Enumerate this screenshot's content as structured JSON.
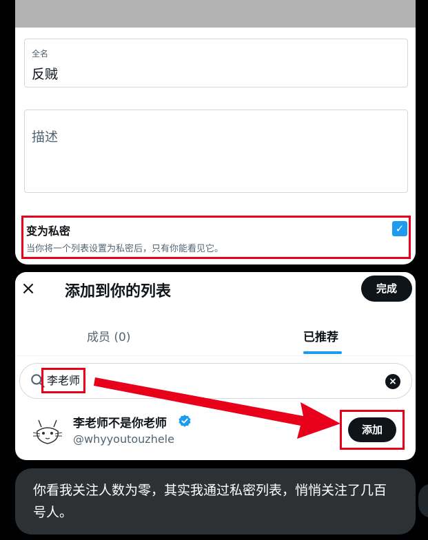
{
  "list_editor": {
    "name_label": "全名",
    "name_value": "反贼",
    "description_placeholder": "描述",
    "private_title": "变为私密",
    "private_description": "当你将一个列表设置为私密后，只有你能看见它。",
    "private_checked": true
  },
  "add_dialog": {
    "title": "添加到你的列表",
    "done_label": "完成",
    "tabs": [
      {
        "label": "成员 (0)",
        "active": false
      },
      {
        "label": "已推荐",
        "active": true
      }
    ],
    "search_value": "李老师",
    "user": {
      "name": "李老师不是你老师",
      "handle": "@whyyoutouzhele",
      "verified": true,
      "add_label": "添加"
    }
  },
  "caption": "你看我关注人数为零，其实我通过私密列表，悄悄关注了几百号人。",
  "colors": {
    "accent": "#1d9bf0",
    "annotation_red": "#e8001b",
    "button_dark": "#0f1419"
  }
}
